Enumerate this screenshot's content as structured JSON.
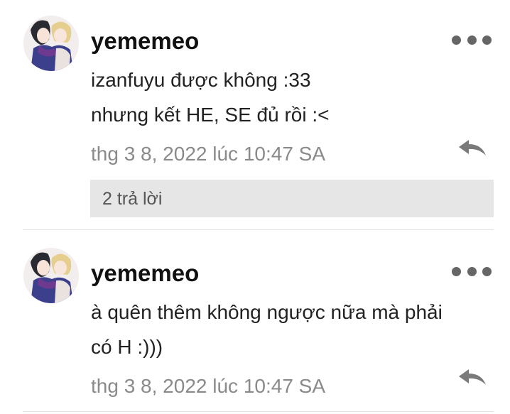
{
  "comments": [
    {
      "username": "yememeo",
      "avatar": "anime-couple-avatar",
      "lines": [
        "izanfuyu được không :33",
        "nhưng kết HE, SE đủ rồi :<"
      ],
      "timestamp": "thg 3 8, 2022 lúc 10:47 SA",
      "replies_label": "2 trả lời"
    },
    {
      "username": "yememeo",
      "avatar": "anime-couple-avatar",
      "lines": [
        "à quên thêm không ngược nữa mà phải",
        "có H :)))"
      ],
      "timestamp": "thg 3 8, 2022 lúc 10:47 SA"
    }
  ],
  "icons": {
    "more": "more-dots-icon",
    "reply": "reply-arrow-icon"
  },
  "colors": {
    "username": "#111111",
    "text": "#222222",
    "meta": "#8a8a8a",
    "replies_bg": "#e6e6e6",
    "icon": "#666666"
  }
}
